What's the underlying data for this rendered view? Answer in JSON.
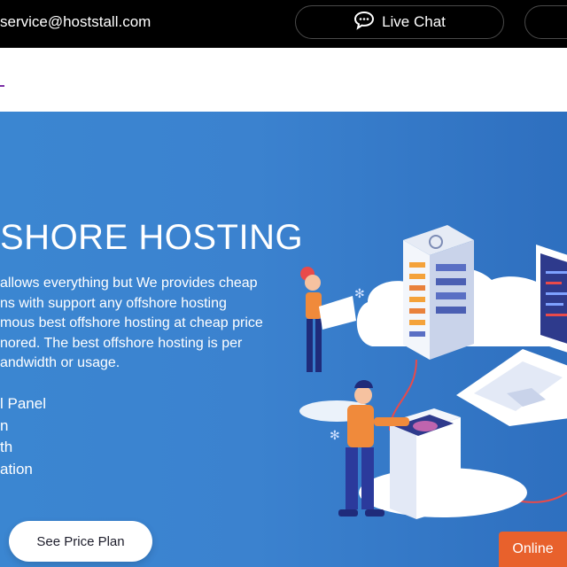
{
  "topbar": {
    "email": "service@hoststall.com",
    "live_chat_label": "Live Chat"
  },
  "hero": {
    "title": "SHORE HOSTING",
    "description_lines": [
      "allows everything but We provides cheap",
      "ns with support any offshore hosting",
      "mous best offshore hosting at cheap price",
      "nored. The best offshore hosting is per",
      "andwidth or usage."
    ],
    "features": [
      "l Panel",
      "n",
      "th",
      "ation"
    ],
    "cta_label": "See Price Plan"
  },
  "chat_widget": {
    "label": "Online"
  },
  "colors": {
    "topbar_bg": "#000000",
    "hero_bg": "#3b82cf",
    "accent_orange": "#e8612c",
    "logo_purple": "#7b2fa6"
  },
  "icons": {
    "live_chat": "chat-bubble-icon"
  }
}
